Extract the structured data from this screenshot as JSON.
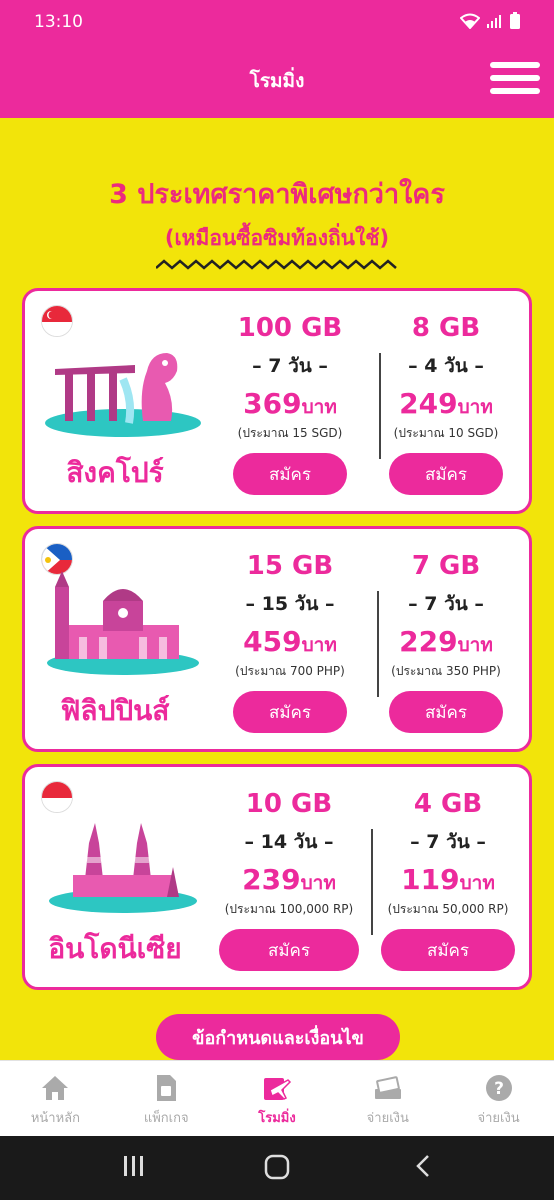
{
  "status_bar": {
    "time": "13:10"
  },
  "header": {
    "title": "โรมมิ่ง"
  },
  "promo": {
    "heading": "3 ประเทศราคาพิเศษกว่าใคร",
    "subheading": "(เหมือนซื้อซิมท้องถิ่นใช้)"
  },
  "countries": [
    {
      "name": "สิงคโปร์",
      "plans": [
        {
          "data": "100 GB",
          "days": "– 7 วัน –",
          "price": "369",
          "unit": "บาท",
          "approx": "(ประมาณ 15 SGD)",
          "button": "สมัคร"
        },
        {
          "data": "8 GB",
          "days": "– 4 วัน –",
          "price": "249",
          "unit": "บาท",
          "approx": "(ประมาณ 10 SGD)",
          "button": "สมัคร"
        }
      ]
    },
    {
      "name": "ฟิลิปปินส์",
      "plans": [
        {
          "data": "15 GB",
          "days": "– 15 วัน –",
          "price": "459",
          "unit": "บาท",
          "approx": "(ประมาณ 700 PHP)",
          "button": "สมัคร"
        },
        {
          "data": "7 GB",
          "days": "– 7 วัน –",
          "price": "229",
          "unit": "บาท",
          "approx": "(ประมาณ 350 PHP)",
          "button": "สมัคร"
        }
      ]
    },
    {
      "name": "อินโดนีเซีย",
      "plans": [
        {
          "data": "10 GB",
          "days": "– 14 วัน –",
          "price": "239",
          "unit": "บาท",
          "approx": "(ประมาณ 100,000 RP)",
          "button": "สมัคร"
        },
        {
          "data": "4 GB",
          "days": "– 7 วัน –",
          "price": "119",
          "unit": "บาท",
          "approx": "(ประมาณ 50,000 RP)",
          "button": "สมัคร"
        }
      ]
    }
  ],
  "terms_button": "ข้อกำหนดและเงื่อนไข",
  "bottom_nav": [
    {
      "label": "หน้าหลัก",
      "icon": "home-icon"
    },
    {
      "label": "แพ็กเกจ",
      "icon": "sim-card-icon"
    },
    {
      "label": "โรมมิ่ง",
      "icon": "roaming-plane-icon"
    },
    {
      "label": "จ่ายเงิน",
      "icon": "payment-icon"
    },
    {
      "label": "จ่ายเงิน",
      "icon": "help-icon"
    }
  ],
  "colors": {
    "primary": "#ec2a9c",
    "background": "#f2e40a"
  }
}
